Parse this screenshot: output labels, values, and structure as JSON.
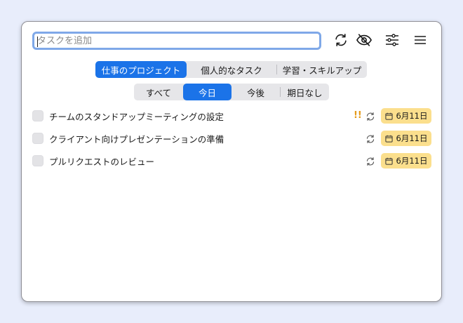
{
  "add_task": {
    "placeholder": "タスクを追加"
  },
  "toolbar": {
    "sync_icon": "sync-icon",
    "hide_icon": "eye-slash-icon",
    "filter_icon": "sliders-icon",
    "menu_icon": "hamburger-menu-icon"
  },
  "projects": [
    {
      "label": "仕事のプロジェクト",
      "active": true
    },
    {
      "label": "個人的なタスク",
      "active": false
    },
    {
      "label": "学習・スキルアップ",
      "active": false
    }
  ],
  "filters": [
    {
      "label": "すべて",
      "active": false
    },
    {
      "label": "今日",
      "active": true
    },
    {
      "label": "今後",
      "active": false
    },
    {
      "label": "期日なし",
      "active": false
    }
  ],
  "tasks": [
    {
      "title": "チームのスタンドアップミーティングの設定",
      "priority": "!!",
      "repeat": true,
      "due": "6月11日"
    },
    {
      "title": "クライアント向けプレゼンテーションの準備",
      "priority": "",
      "repeat": true,
      "due": "6月11日"
    },
    {
      "title": "プルリクエストのレビュー",
      "priority": "",
      "repeat": true,
      "due": "6月11日"
    }
  ],
  "colors": {
    "accent": "#1b73e8",
    "badge": "#fbdf8d",
    "priority": "#e59a1a",
    "focus_ring": "#7fa8e8"
  }
}
